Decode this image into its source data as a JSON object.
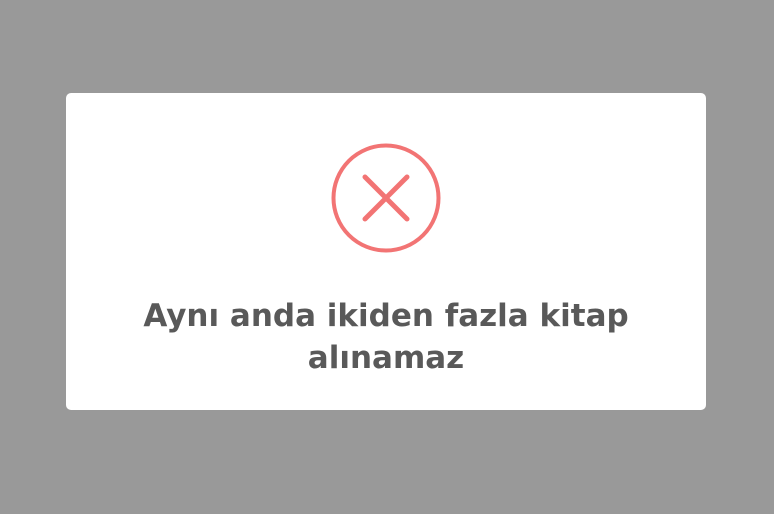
{
  "dialog": {
    "icon": "error-x-icon",
    "icon_color": "#f27474",
    "message": "Aynı anda ikiden fazla kitap alınamaz"
  },
  "colors": {
    "backdrop": "#999999",
    "modal_background": "#ffffff",
    "text": "#595959"
  }
}
